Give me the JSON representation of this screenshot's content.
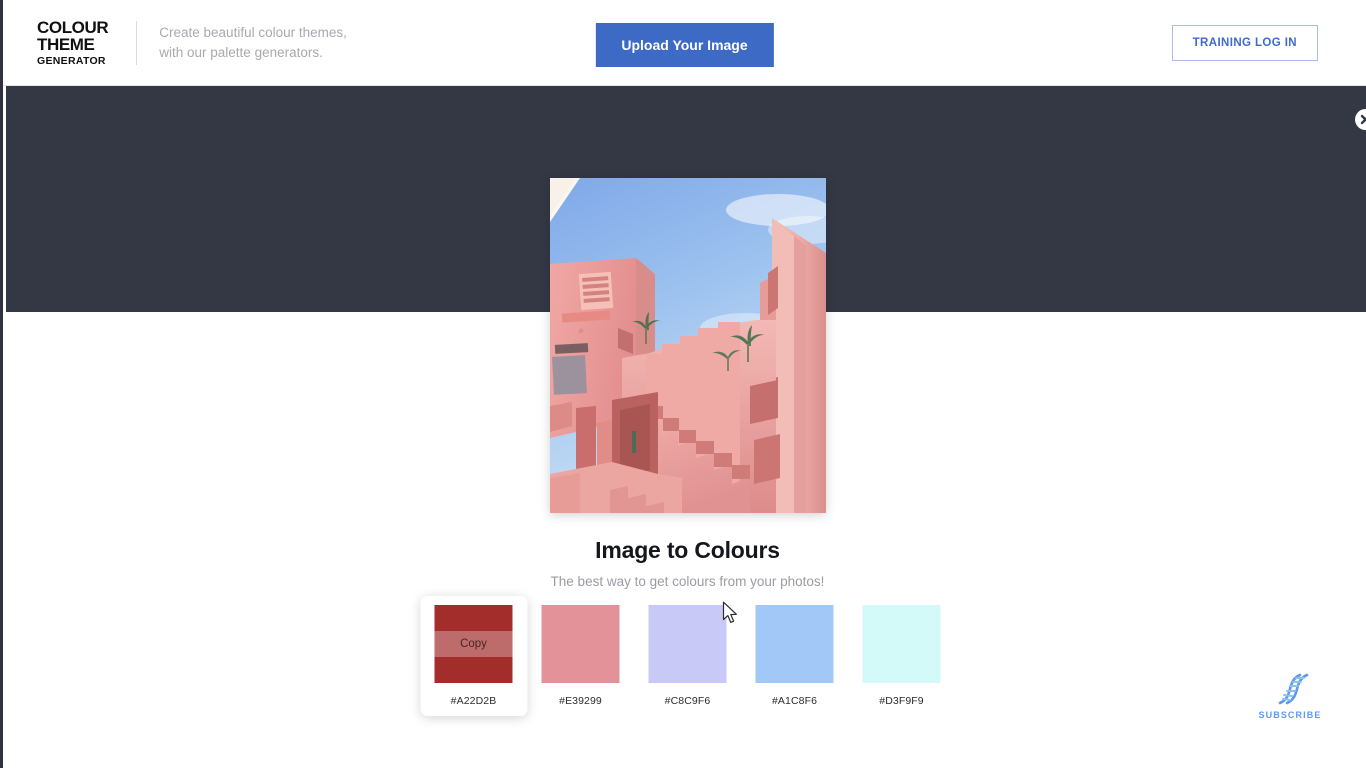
{
  "header": {
    "logo": {
      "line1": "COLOUR",
      "line2": "THEME",
      "line3": "GENERATOR"
    },
    "tagline_line1": "Create beautiful colour themes,",
    "tagline_line2": "with our palette generators.",
    "login_label": "TRAINING LOG IN",
    "login_text_color": "#3e6ad0",
    "login_border_color": "#a9bde9"
  },
  "banner": {
    "background_color": "#343845",
    "upload_label": "Upload Your Image",
    "upload_color": "#3c6ac4",
    "close_icon": "close-circle-icon"
  },
  "main": {
    "photo_alt": "pink-architecture-photo",
    "title": "Image to Colours",
    "subtitle": "The best way to get colours from your photos!"
  },
  "palette": {
    "copy_label": "Copy",
    "active_index": 0,
    "swatches": [
      {
        "hex": "#A22D2B",
        "label": "#A22D2B"
      },
      {
        "hex": "#E39299",
        "label": "#E39299"
      },
      {
        "hex": "#C8C9F6",
        "label": "#C8C9F6"
      },
      {
        "hex": "#A1C8F6",
        "label": "#A1C8F6"
      },
      {
        "hex": "#D3F9F9",
        "label": "#D3F9F9"
      }
    ]
  },
  "subscribe": {
    "label": "SUBSCRIBE",
    "icon": "dna-helix-icon",
    "color": "#5d9bea"
  }
}
